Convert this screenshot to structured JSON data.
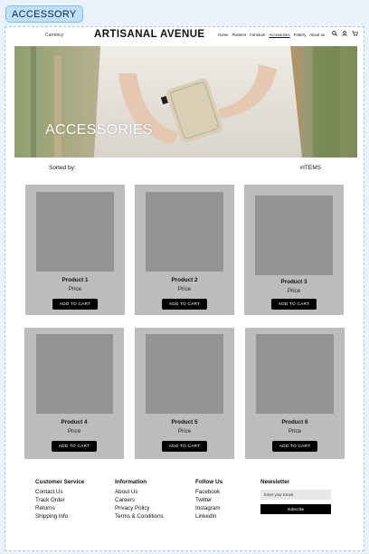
{
  "page_tag": "ACCESSORY",
  "header": {
    "currency": "Currency",
    "brand": "ARTISANAL AVENUE",
    "nav": [
      "Home",
      "Planters",
      "Furniture",
      "Accessories",
      "Pottery",
      "About us"
    ],
    "active_nav": "Accessories",
    "icons": [
      "search-icon",
      "user-icon",
      "cart-icon"
    ]
  },
  "hero": {
    "title": "ACCESSORIES"
  },
  "sortbar": {
    "sort_label": "Sorted by:",
    "items_label": "#ITEMS"
  },
  "products": [
    {
      "name": "Product 1",
      "price": "Price",
      "cta": "ADD TO CART"
    },
    {
      "name": "Product 2",
      "price": "Price",
      "cta": "ADD TO CART"
    },
    {
      "name": "Product 3",
      "price": "Price",
      "cta": "ADD TO CART"
    },
    {
      "name": "Product 4",
      "price": "Price",
      "cta": "ADD TO CART"
    },
    {
      "name": "Product 5",
      "price": "Price",
      "cta": "ADD TO CART"
    },
    {
      "name": "Product 6",
      "price": "Price",
      "cta": "ADD TO CART"
    }
  ],
  "footer": {
    "customer_service": {
      "title": "Customer Service",
      "links": [
        "Contact Us",
        "Track Order",
        "Returns",
        "Shipping Info"
      ]
    },
    "information": {
      "title": "Information",
      "links": [
        "About Us",
        "Careers",
        "Privacy Policy",
        "Terms & Conditions"
      ]
    },
    "follow_us": {
      "title": "Follow Us",
      "links": [
        "Facebook",
        "Twitter",
        "Instagram",
        "LinkedIn"
      ]
    },
    "newsletter": {
      "title": "Newsletter",
      "placeholder": "Enter your Email",
      "button": "Subscribe"
    }
  },
  "colors": {
    "card_bg": "#bcbcbc",
    "thumb_bg": "#939393",
    "button_bg": "#000000",
    "tag_bg": "#bfe0f7"
  }
}
